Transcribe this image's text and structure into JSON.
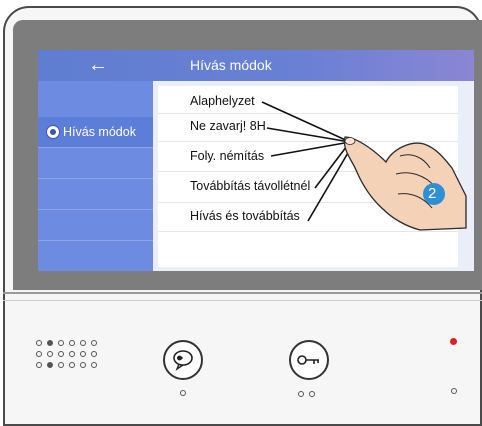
{
  "header": {
    "back_icon": "←",
    "title": "Hívás módok"
  },
  "sidebar": {
    "items": [
      {
        "label": "Hívás módok",
        "icon": "mode-icon"
      }
    ]
  },
  "menu": {
    "items": [
      {
        "label": "Alaphelyzet"
      },
      {
        "label": "Ne zavarj! 8H"
      },
      {
        "label": "Foly. némítás"
      },
      {
        "label": "Továbbítás távollétnél"
      },
      {
        "label": "Hívás és továbbítás"
      }
    ]
  },
  "callout": {
    "number": "2"
  },
  "device": {
    "buttons": [
      {
        "icon": "talk-icon"
      },
      {
        "icon": "key-icon"
      }
    ],
    "led_color": "#e02020",
    "accent_color": "#6d8be0"
  }
}
